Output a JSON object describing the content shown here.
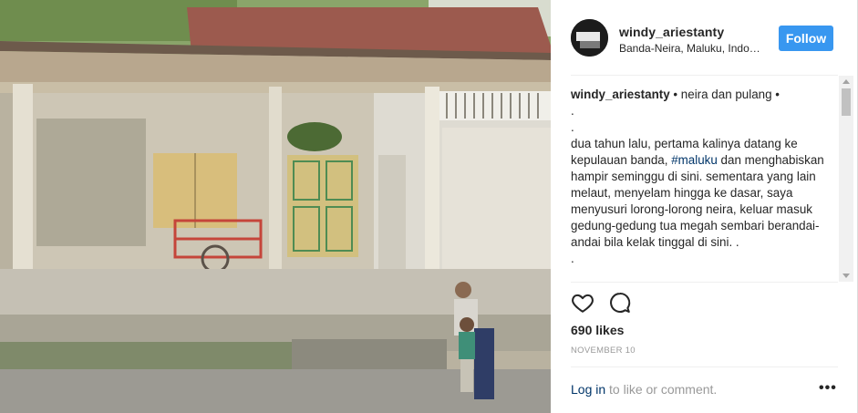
{
  "post": {
    "username": "windy_ariestanty",
    "location": "Banda-Neira, Maluku, Indo…",
    "follow_label": "Follow",
    "caption": {
      "username": "windy_ariestanty",
      "first_line": "• neira dan pulang •",
      "dot_1": ".",
      "dot_2": ".",
      "body_before_tag": "dua tahun lalu, pertama kalinya datang ke kepulauan banda, ",
      "hashtag": "#maluku",
      "body_after_tag": " dan menghabiskan hampir seminggu di sini. sementara yang lain melaut, menyelam hingga ke dasar, saya menyusuri lorong-lorong neira, keluar masuk gedung-gedung tua megah sembari berandai-andai bila kelak tinggal di sini. .",
      "dot_3": "."
    },
    "likes": "690 likes",
    "date": "NOVEMBER 10",
    "login_link": "Log in",
    "login_rest": " to like or comment.",
    "more_glyph": "•••"
  },
  "icons": [
    "heart-icon",
    "comment-icon",
    "more-options-icon"
  ],
  "colors": {
    "follow_bg": "#3897f0",
    "link": "#003569",
    "muted": "#999999"
  }
}
